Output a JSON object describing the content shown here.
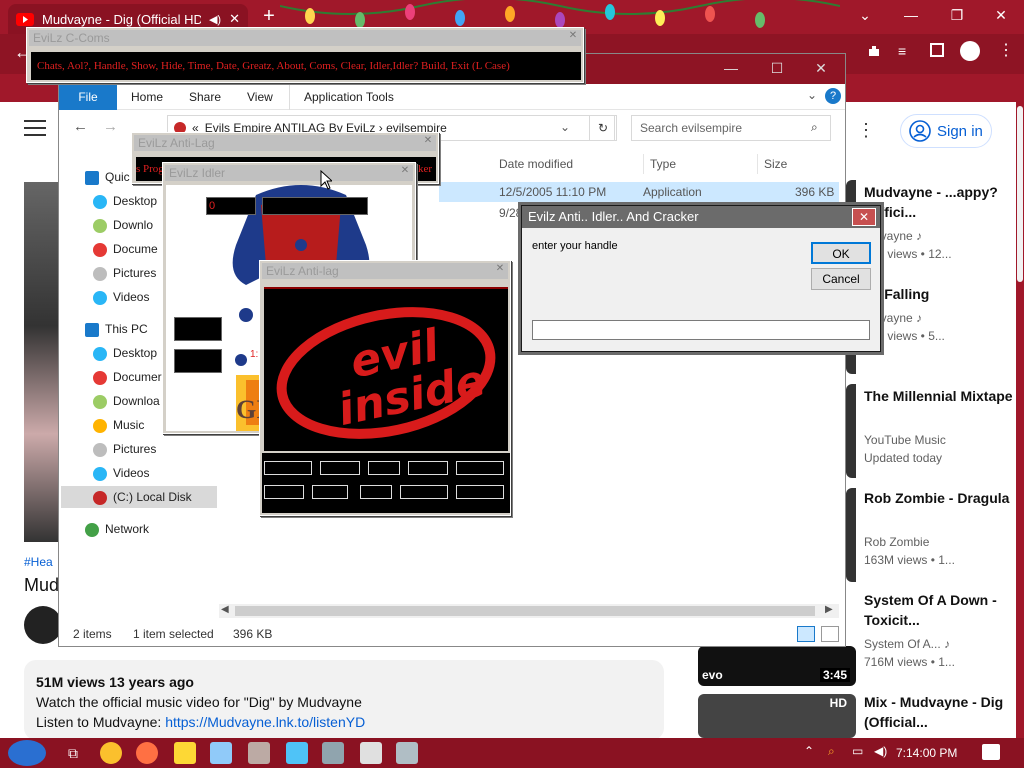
{
  "browser": {
    "tab_title": "Mudvayne - Dig (Official HD",
    "tab_close": "✕",
    "new_tab": "+",
    "win_minimize": "—",
    "win_restore": "❐",
    "win_close": "✕"
  },
  "youtube": {
    "sign_in": "Sign in",
    "tag": "#Hea",
    "video_title": "Mud",
    "views_line": "51M views  13 years ago",
    "desc_line1": "Watch the official music video for \"Dig\" by Mudvayne",
    "desc_line2_prefix": "Listen to Mudvayne: ",
    "desc_link": "https://Mudvayne.lnk.to/listenYD",
    "recommendations": [
      {
        "title": "Mudvayne - ...appy? (Offici...",
        "sub1": "...dvayne ♪",
        "sub2": "...M views • 12..."
      },
      {
        "title": "...t Falling",
        "sub1": "...dvayne ♪",
        "sub2": "...M views • 5..."
      },
      {
        "title": "The Millennial Mixtape",
        "sub1": "YouTube Music",
        "sub2": "Updated today"
      },
      {
        "title": "Rob Zombie - Dragula",
        "sub1": "Rob Zombie",
        "sub2": "163M views • 1..."
      },
      {
        "title": "System Of A Down - Toxicit...",
        "sub1": "System Of A... ♪",
        "sub2": "716M views • 1...",
        "duration": "3:45",
        "badge": "evo"
      },
      {
        "title": "Mix - Mudvayne - Dig (Official...",
        "badge": "HD"
      }
    ]
  },
  "explorer": {
    "ribbon_tabs": [
      "File",
      "Home",
      "Share",
      "View",
      "Application Tools"
    ],
    "address": "Evils Empire ANTILAG By EviLz  ›  evilsempire",
    "address_prefix": "«",
    "search_placeholder": "Search evilsempire",
    "columns": {
      "date": "Date modified",
      "type": "Type",
      "size": "Size"
    },
    "rows": [
      {
        "date": "12/5/2005 11:10 PM",
        "type": "Application",
        "size": "396 KB"
      },
      {
        "date": "9/28",
        "type": "",
        "size": ""
      }
    ],
    "nav": {
      "quick": "Quic",
      "quick_items": [
        "Desktop",
        "Downlo",
        "Docume",
        "Pictures",
        "Videos"
      ],
      "this_pc": "This PC",
      "pc_items": [
        "Desktop",
        "Documer",
        "Downloa",
        "Music",
        "Pictures",
        "Videos",
        "(C:) Local Disk"
      ],
      "network": "Network"
    },
    "status": {
      "items": "2 items",
      "selected": "1 item selected",
      "size": "396 KB"
    }
  },
  "ccoms": {
    "title": "EviLz C-Coms",
    "commands": "Chats, Aol?, Handle, Show, Hide, Time, Date, Greatz, About, Coms, Clear, Idler,Idler? Build, Exit (L Case)"
  },
  "antilag1": {
    "title": "EviLz Anti-Lag",
    "strip_left": "s Prog",
    "strip_right": "cker"
  },
  "idler": {
    "title": "EviLz Idler",
    "counter": "0",
    "art_text": "GI",
    "side_label": "1:"
  },
  "antilag2": {
    "title": "EviLz Anti-lag",
    "logo_line1": "evil",
    "logo_line2": "inside"
  },
  "dialog": {
    "title": "Evilz Anti.. Idler.. And Cracker",
    "prompt": "enter your handle",
    "ok": "OK",
    "cancel": "Cancel",
    "input_value": ""
  },
  "taskbar": {
    "clock": "7:14:00 PM"
  },
  "colors": {
    "theme_red": "#a0182a",
    "explorer_accent": "#1979ca",
    "evil_red": "#e02020"
  }
}
